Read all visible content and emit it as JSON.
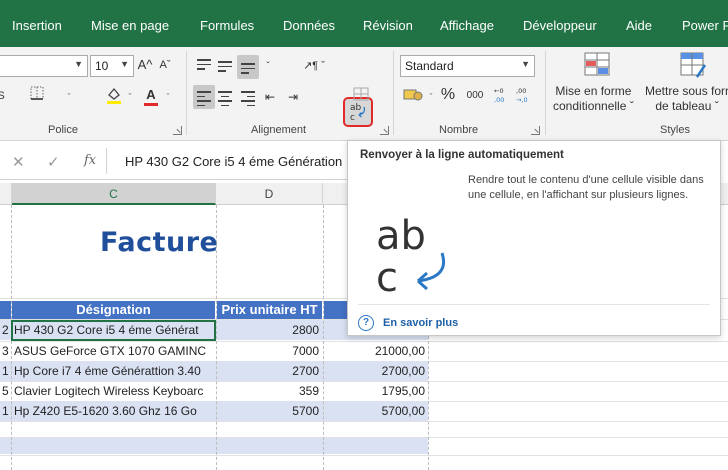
{
  "tabs": [
    "Insertion",
    "Mise en page",
    "Formules",
    "Données",
    "Révision",
    "Affichage",
    "Développeur",
    "Aide",
    "Power P"
  ],
  "ribbon": {
    "font_size": "10",
    "number_format": "Standard",
    "groups": {
      "police": "Police",
      "alignement": "Alignement",
      "nombre": "Nombre",
      "styles": "Styles"
    },
    "labels": {
      "grow_font": "A^",
      "shrink_font": "Aˇ",
      "percent": "%",
      "thousands": "000",
      "conditional_1": "Mise en forme",
      "conditional_2": "conditionnelle ˇ",
      "table_1": "Mettre sous forr",
      "table_2": "de tableau ˇ"
    }
  },
  "formula_bar": {
    "fx": "fx",
    "content": "HP 430 G2 Core i5 4 éme Génération"
  },
  "columns": {
    "c": "C",
    "d": "D"
  },
  "sheet": {
    "title": "Facture",
    "headers": {
      "designation": "Désignation",
      "prix": "Prix unitaire HT"
    },
    "rows": [
      {
        "qty": "2",
        "designation": "HP 430 G2 Core i5 4 éme Générat",
        "prix": "2800",
        "total": ""
      },
      {
        "qty": "3",
        "designation": "ASUS GeForce GTX 1070 GAMINC",
        "prix": "7000",
        "total": "21000,00"
      },
      {
        "qty": "1",
        "designation": "Hp Core i7 4 éme Générattion 3.40",
        "prix": "2700",
        "total": "2700,00"
      },
      {
        "qty": "5",
        "designation": "Clavier Logitech Wireless Keyboarc",
        "prix": "359",
        "total": "1795,00"
      },
      {
        "qty": "1",
        "designation": "Hp Z420 E5-1620 3.60 Ghz 16 Go",
        "prix": "5700",
        "total": "5700,00"
      }
    ]
  },
  "tooltip": {
    "title": "Renvoyer à la ligne automatiquement",
    "description": "Rendre tout le contenu d'une cellule visible dans une cellule, en l'affichant sur plusieurs lignes.",
    "link": "En savoir plus",
    "big_top": "ab",
    "big_bottom": "c"
  },
  "colors": {
    "excel_green": "#217346",
    "table_header": "#4472c4",
    "band": "#d9e1f2",
    "title_blue": "#1f4e9a",
    "highlight": "#e02a2a",
    "link_blue": "#1f5fa8"
  },
  "icons": [
    "cut-icon",
    "fill-color-icon",
    "font-color-icon",
    "border-icon",
    "align-top-icon",
    "align-middle-icon",
    "align-bottom-icon",
    "orientation-icon",
    "align-left-icon",
    "align-center-icon",
    "align-right-icon",
    "indent-icon",
    "wrap-text-icon",
    "merge-icon",
    "accounting-icon",
    "decimal-increase-icon",
    "decimal-decrease-icon",
    "conditional-format-icon",
    "format-table-icon",
    "cancel-icon",
    "confirm-icon",
    "help-icon"
  ]
}
